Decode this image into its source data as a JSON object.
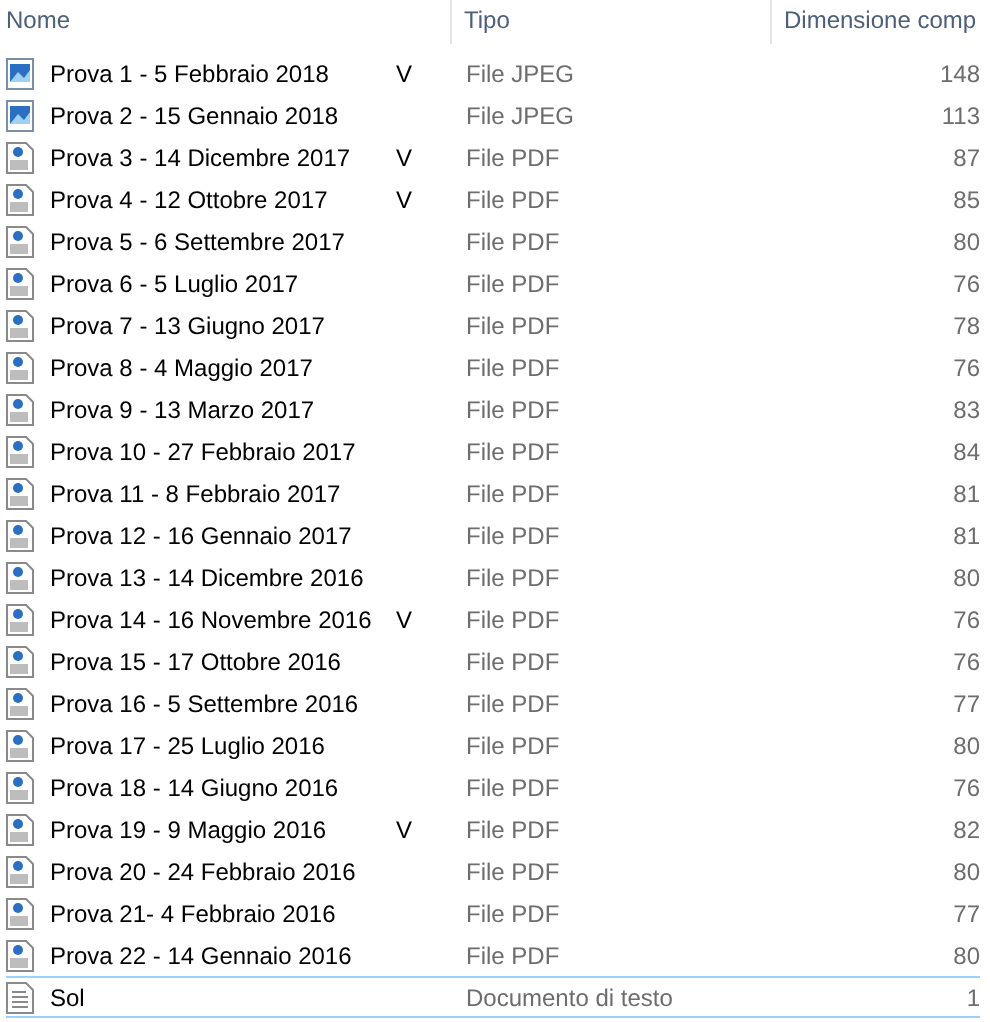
{
  "columns": [
    "Nome",
    "Tipo",
    "Dimensione comp"
  ],
  "rows": [
    {
      "name": "Prova 1 - 5 Febbraio 2018",
      "mark": "V",
      "type": "File JPEG",
      "size": "148",
      "kind": "image",
      "focused": false
    },
    {
      "name": "Prova 2 - 15 Gennaio 2018",
      "type": "File JPEG",
      "size": "113",
      "kind": "image",
      "focused": false
    },
    {
      "name": "Prova 3 - 14 Dicembre 2017",
      "mark": "V",
      "type": "File PDF",
      "size": "87",
      "kind": "pdf",
      "focused": false
    },
    {
      "name": "Prova 4 - 12 Ottobre 2017",
      "mark": "V",
      "type": "File PDF",
      "size": "85",
      "kind": "pdf",
      "focused": false
    },
    {
      "name": "Prova 5 - 6 Settembre 2017",
      "type": "File PDF",
      "size": "80",
      "kind": "pdf",
      "focused": false
    },
    {
      "name": "Prova 6 - 5 Luglio 2017",
      "type": "File PDF",
      "size": "76",
      "kind": "pdf",
      "focused": false
    },
    {
      "name": "Prova 7 - 13 Giugno 2017",
      "type": "File PDF",
      "size": "78",
      "kind": "pdf",
      "focused": false
    },
    {
      "name": "Prova 8 - 4 Maggio 2017",
      "type": "File PDF",
      "size": "76",
      "kind": "pdf",
      "focused": false
    },
    {
      "name": "Prova 9 - 13 Marzo 2017",
      "type": "File PDF",
      "size": "83",
      "kind": "pdf",
      "focused": false
    },
    {
      "name": "Prova 10 - 27 Febbraio 2017",
      "type": "File PDF",
      "size": "84",
      "kind": "pdf",
      "focused": false
    },
    {
      "name": "Prova 11 - 8 Febbraio 2017",
      "type": "File PDF",
      "size": "81",
      "kind": "pdf",
      "focused": false
    },
    {
      "name": "Prova 12 - 16 Gennaio 2017",
      "type": "File PDF",
      "size": "81",
      "kind": "pdf",
      "focused": false
    },
    {
      "name": "Prova 13 - 14 Dicembre 2016",
      "type": "File PDF",
      "size": "80",
      "kind": "pdf",
      "focused": false
    },
    {
      "name": "Prova 14 - 16 Novembre 2016",
      "mark": "V",
      "type": "File PDF",
      "size": "76",
      "kind": "pdf",
      "focused": false
    },
    {
      "name": "Prova 15 - 17 Ottobre 2016",
      "type": "File PDF",
      "size": "76",
      "kind": "pdf",
      "focused": false
    },
    {
      "name": "Prova 16 - 5 Settembre 2016",
      "type": "File PDF",
      "size": "77",
      "kind": "pdf",
      "focused": false
    },
    {
      "name": "Prova 17 - 25 Luglio 2016",
      "type": "File PDF",
      "size": "80",
      "kind": "pdf",
      "focused": false
    },
    {
      "name": "Prova 18 - 14 Giugno 2016",
      "type": "File PDF",
      "size": "76",
      "kind": "pdf",
      "focused": false
    },
    {
      "name": "Prova 19 - 9 Maggio 2016",
      "mark": "V",
      "type": "File PDF",
      "size": "82",
      "kind": "pdf",
      "focused": false
    },
    {
      "name": "Prova 20 - 24 Febbraio 2016",
      "type": "File PDF",
      "size": "80",
      "kind": "pdf",
      "focused": false
    },
    {
      "name": "Prova 21- 4 Febbraio 2016",
      "type": "File PDF",
      "size": "77",
      "kind": "pdf",
      "focused": false
    },
    {
      "name": "Prova 22 - 14 Gennaio 2016",
      "type": "File PDF",
      "size": "80",
      "kind": "pdf",
      "focused": false
    },
    {
      "name": "Sol",
      "type": "Documento di testo",
      "size": "1",
      "kind": "text",
      "focused": true
    }
  ]
}
